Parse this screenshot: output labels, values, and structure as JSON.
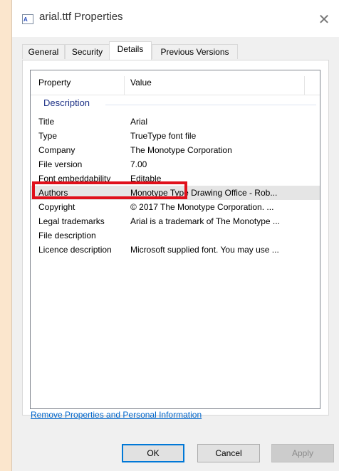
{
  "window": {
    "title": "arial.ttf Properties",
    "close_glyph": "✕",
    "title_icon": "font-file-icon",
    "title_icon_glyph": "A"
  },
  "tabs": [
    {
      "label": "General"
    },
    {
      "label": "Security"
    },
    {
      "label": "Details",
      "active": true
    },
    {
      "label": "Previous Versions"
    }
  ],
  "details": {
    "columns": [
      "Property",
      "Value"
    ],
    "group": "Description",
    "rows": [
      {
        "property": "Title",
        "value": "Arial"
      },
      {
        "property": "Type",
        "value": "TrueType font file"
      },
      {
        "property": "Company",
        "value": "The Monotype Corporation"
      },
      {
        "property": "File version",
        "value": "7.00"
      },
      {
        "property": "Font embeddability",
        "value": "Editable"
      },
      {
        "property": "Authors",
        "value": "Monotype Type Drawing Office - Rob..."
      },
      {
        "property": "Copyright",
        "value": "© 2017 The Monotype Corporation. ..."
      },
      {
        "property": "Legal trademarks",
        "value": "Arial is a trademark of The Monotype ..."
      },
      {
        "property": "File description",
        "value": ""
      },
      {
        "property": "Licence description",
        "value": "Microsoft supplied font. You may use ..."
      }
    ],
    "selected_row": 5
  },
  "remove_link": "Remove Properties and Personal Information",
  "buttons": {
    "ok": "OK",
    "cancel": "Cancel",
    "apply": "Apply"
  },
  "colors": {
    "highlight": "#e0101b",
    "link": "#0066cc",
    "group": "#1e3287"
  }
}
